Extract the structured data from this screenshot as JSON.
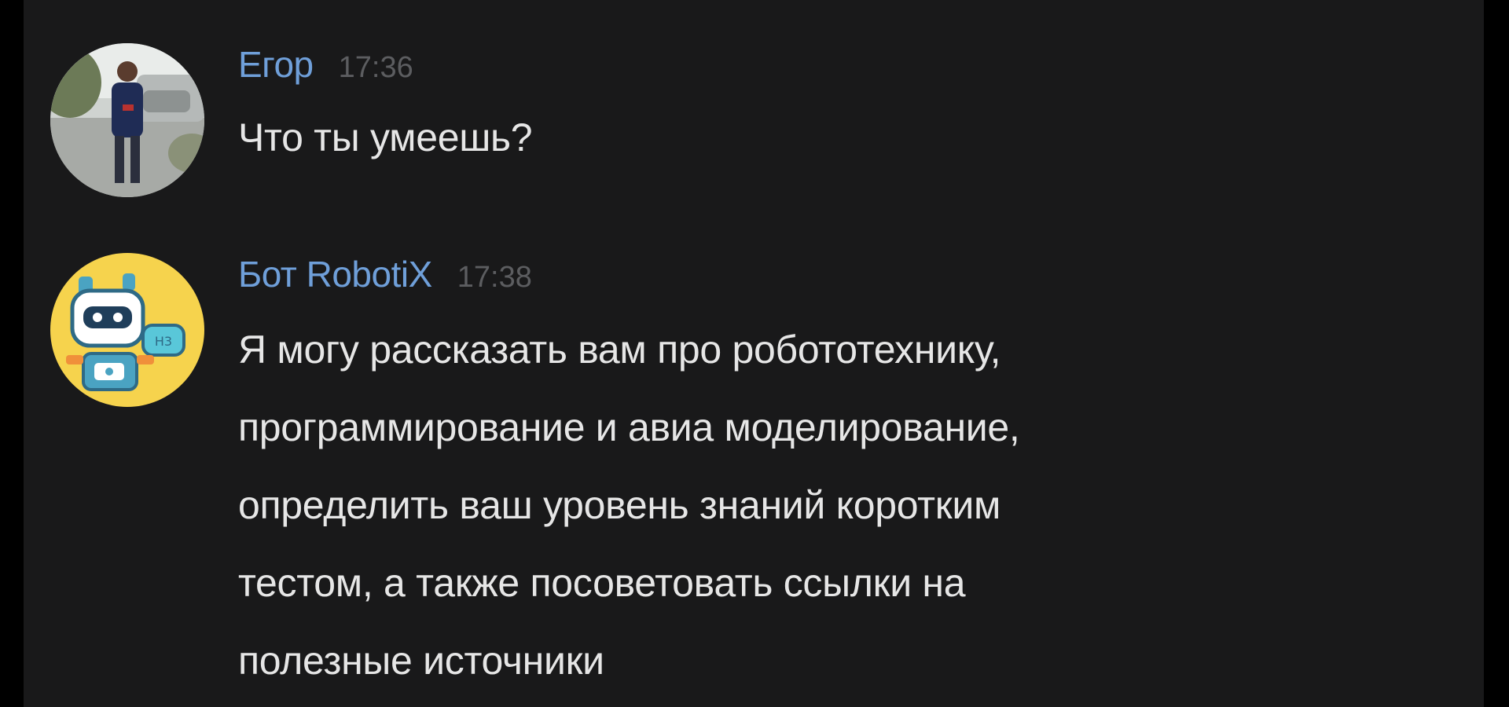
{
  "messages": [
    {
      "author": "Егор",
      "time": "17:36",
      "text": "Что ты умеешь?",
      "avatar_icon": "user-photo-avatar"
    },
    {
      "author": "Бот RobotiX",
      "time": "17:38",
      "text": "Я могу рассказать вам про робототехнику,\nпрограммирование и авиа моделирование,\nопределить ваш уровень знаний коротким\nтестом, а также посоветовать ссылки на\nполезные источники",
      "avatar_icon": "robot-avatar"
    }
  ],
  "colors": {
    "background": "#19191a",
    "author": "#6f9fd9",
    "time": "#5c5d60",
    "text": "#e6e6e6",
    "bot_avatar_bg": "#f6d34d"
  }
}
